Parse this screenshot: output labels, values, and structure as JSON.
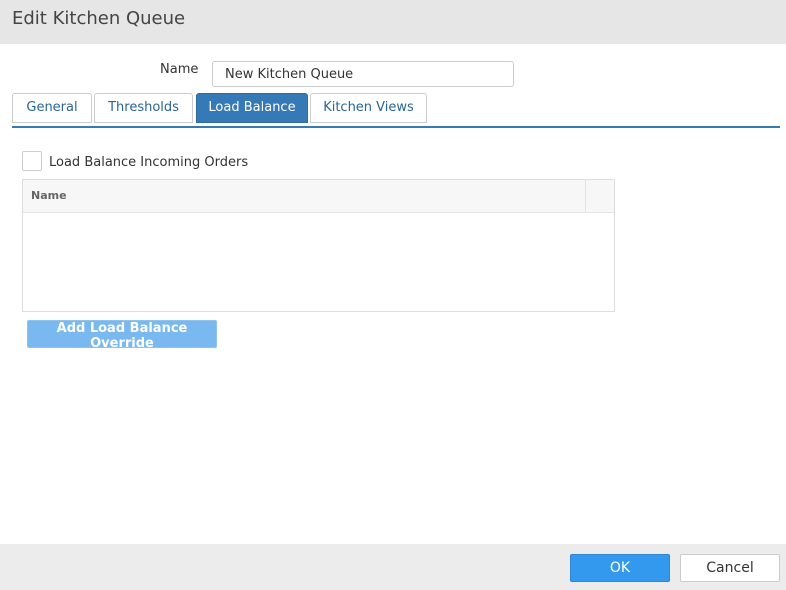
{
  "dialog": {
    "title": "Edit Kitchen Queue"
  },
  "name_field": {
    "label": "Name",
    "value": "New Kitchen Queue"
  },
  "tabs": [
    {
      "label": "General",
      "active": false
    },
    {
      "label": "Thresholds",
      "active": false
    },
    {
      "label": "Load Balance",
      "active": true
    },
    {
      "label": "Kitchen Views",
      "active": false
    }
  ],
  "load_balance": {
    "checkbox_label": "Load Balance Incoming Orders",
    "checked": false,
    "grid": {
      "columns": [
        "Name"
      ],
      "rows": []
    },
    "add_button_label": "Add Load Balance Override"
  },
  "footer": {
    "ok_label": "OK",
    "cancel_label": "Cancel"
  },
  "colors": {
    "accent": "#3579b6",
    "ok_button": "#3399ee",
    "add_button": "#7ab8f0",
    "titlebar": "#e6e6e6",
    "footer": "#ececec"
  }
}
